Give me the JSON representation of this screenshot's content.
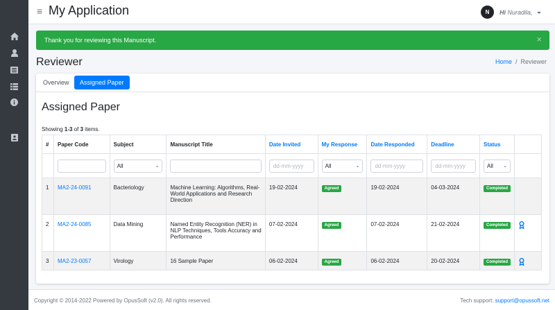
{
  "app": {
    "title": "My Application"
  },
  "user": {
    "avatar_initial": "N",
    "greeting": "Hi",
    "name": "Nuradila,"
  },
  "sidebar": {
    "icons": [
      "home-icon",
      "user-icon",
      "list-alt-icon",
      "list-icon",
      "info-circle-icon",
      "address-card-icon"
    ]
  },
  "alert": {
    "message": "Thank you for reviewing this Manuscript.",
    "close": "×"
  },
  "page": {
    "title": "Reviewer"
  },
  "breadcrumb": {
    "home": "Home",
    "separator": "/",
    "current": "Reviewer"
  },
  "tabs": {
    "overview": "Overview",
    "assigned": "Assigned Paper"
  },
  "card": {
    "heading": "Assigned Paper"
  },
  "summary": {
    "prefix": "Showing ",
    "range": "1-3",
    "middle": " of ",
    "total": "3",
    "suffix": " items."
  },
  "table": {
    "headers": {
      "num": "#",
      "paper_code": "Paper Code",
      "subject": "Subject",
      "title": "Manuscript Title",
      "date_invited": "Date Invited",
      "my_response": "My Response",
      "date_responded": "Date Responded",
      "deadline": "Deadline",
      "status": "Status"
    },
    "filters": {
      "subject": "All",
      "date_invited_placeholder": "dd-mm-yyyy",
      "my_response": "All",
      "date_responded_placeholder": "dd-mm-yyyy",
      "deadline_placeholder": "dd-mm-yyyy",
      "status": "All"
    },
    "rows": [
      {
        "num": "1",
        "paper_code": "MA2-24-0091",
        "subject": "Bacteriology",
        "title": "Machine Learning: Algorithms, Real-World Applications and Research Direction",
        "date_invited": "19-02-2024",
        "response": "Agreed",
        "date_responded": "19-02-2024",
        "deadline": "04-03-2024",
        "status": "Completed",
        "has_view": false
      },
      {
        "num": "2",
        "paper_code": "MA2-24-0085",
        "subject": "Data Mining",
        "title": "Named Entity Recognition (NER) in NLP Techniques, Tools Accuracy and Performance",
        "date_invited": "07-02-2024",
        "response": "Agreed",
        "date_responded": "07-02-2024",
        "deadline": "21-02-2024",
        "status": "Completed",
        "has_view": true
      },
      {
        "num": "3",
        "paper_code": "MA2-23-0057",
        "subject": "Virology",
        "title": "16 Sample Paper",
        "date_invited": "06-02-2024",
        "response": "Agreed",
        "date_responded": "06-02-2024",
        "deadline": "20-02-2024",
        "status": "Completed",
        "has_view": true
      }
    ]
  },
  "footer": {
    "copyright": "Copyright © 2014-2022 Powered by OpusSoft (v2.0). All rights reserved.",
    "support_label": "Tech support: ",
    "support_email": "support@opussoft.net"
  },
  "colors": {
    "primary": "#007bff",
    "success": "#28a745",
    "sidebar": "#343a40"
  }
}
